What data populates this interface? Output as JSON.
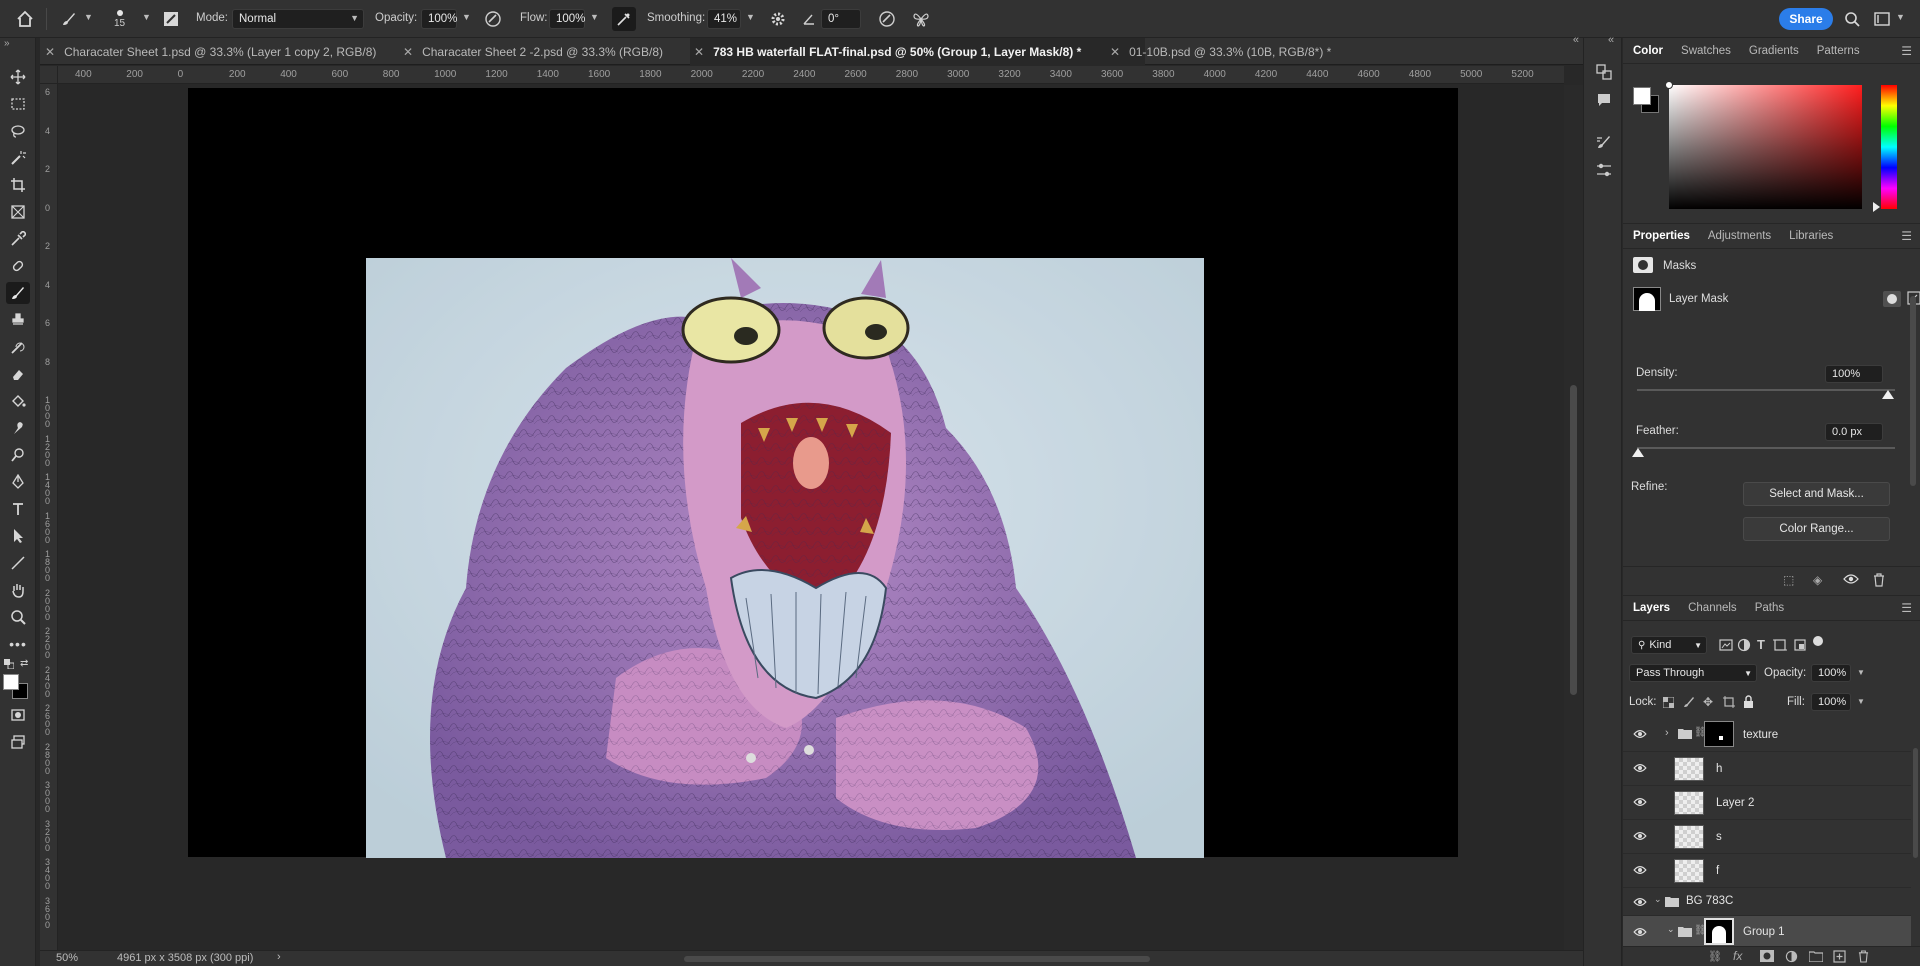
{
  "options_bar": {
    "brush_size": "15",
    "mode_label": "Mode:",
    "mode_value": "Normal",
    "opacity_label": "Opacity:",
    "opacity_value": "100%",
    "flow_label": "Flow:",
    "flow_value": "100%",
    "smoothing_label": "Smoothing:",
    "smoothing_value": "41%",
    "angle_value": "0°",
    "share_label": "Share"
  },
  "tabs": [
    {
      "label": "Characater Sheet 1.psd @ 33.3% (Layer 1 copy 2, RGB/8)",
      "active": false
    },
    {
      "label": "Characater Sheet 2 -2.psd @ 33.3% (RGB/8)",
      "active": false
    },
    {
      "label": "783 HB waterfall FLAT-final.psd @ 50% (Group 1, Layer Mask/8) *",
      "active": true
    },
    {
      "label": "01-10B.psd @ 33.3% (10B, RGB/8*) *",
      "active": false
    }
  ],
  "ruler_h": [
    "400",
    "200",
    "0",
    "200",
    "400",
    "600",
    "800",
    "1000",
    "1200",
    "1400",
    "1600",
    "1800",
    "2000",
    "2200",
    "2400",
    "2600",
    "2800",
    "3000",
    "3200",
    "3400",
    "3600",
    "3800",
    "4000",
    "4200",
    "4400",
    "4600",
    "4800",
    "5000",
    "5200"
  ],
  "ruler_v": [
    "6",
    "4",
    "2",
    "0",
    "2",
    "4",
    "6",
    "8",
    "1 0 0 0",
    "1 2 0 0",
    "1 4 0 0",
    "1 6 0 0",
    "1 8 0 0",
    "2 0 0 0",
    "2 2 0 0",
    "2 4 0 0",
    "2 6 0 0",
    "2 8 0 0",
    "3 0 0 0",
    "3 2 0 0",
    "3 4 0 0",
    "3 6 0 0"
  ],
  "status": {
    "zoom": "50%",
    "doc_info": "4961 px x 3508 px (300 ppi)"
  },
  "color_panel": {
    "tabs": [
      "Color",
      "Swatches",
      "Gradients",
      "Patterns"
    ]
  },
  "properties_panel": {
    "tabs": [
      "Properties",
      "Adjustments",
      "Libraries"
    ],
    "section_label": "Masks",
    "mask_name": "Layer Mask",
    "density_label": "Density:",
    "density_value": "100%",
    "feather_label": "Feather:",
    "feather_value": "0.0 px",
    "refine_label": "Refine:",
    "select_and_mask": "Select and Mask...",
    "color_range": "Color Range..."
  },
  "layers_panel": {
    "tabs": [
      "Layers",
      "Channels",
      "Paths"
    ],
    "filter_kind": "Kind",
    "blend_mode": "Pass Through",
    "opacity_label": "Opacity:",
    "opacity_value": "100%",
    "lock_label": "Lock:",
    "fill_label": "Fill:",
    "fill_value": "100%",
    "layers": [
      {
        "name": "texture",
        "type": "group-collapsed"
      },
      {
        "name": "h",
        "type": "layer"
      },
      {
        "name": "Layer 2",
        "type": "layer"
      },
      {
        "name": "s",
        "type": "layer"
      },
      {
        "name": "f",
        "type": "layer"
      },
      {
        "name": "BG 783C",
        "type": "group-expanded"
      },
      {
        "name": "Group 1",
        "type": "group-expanded-selected"
      }
    ]
  }
}
